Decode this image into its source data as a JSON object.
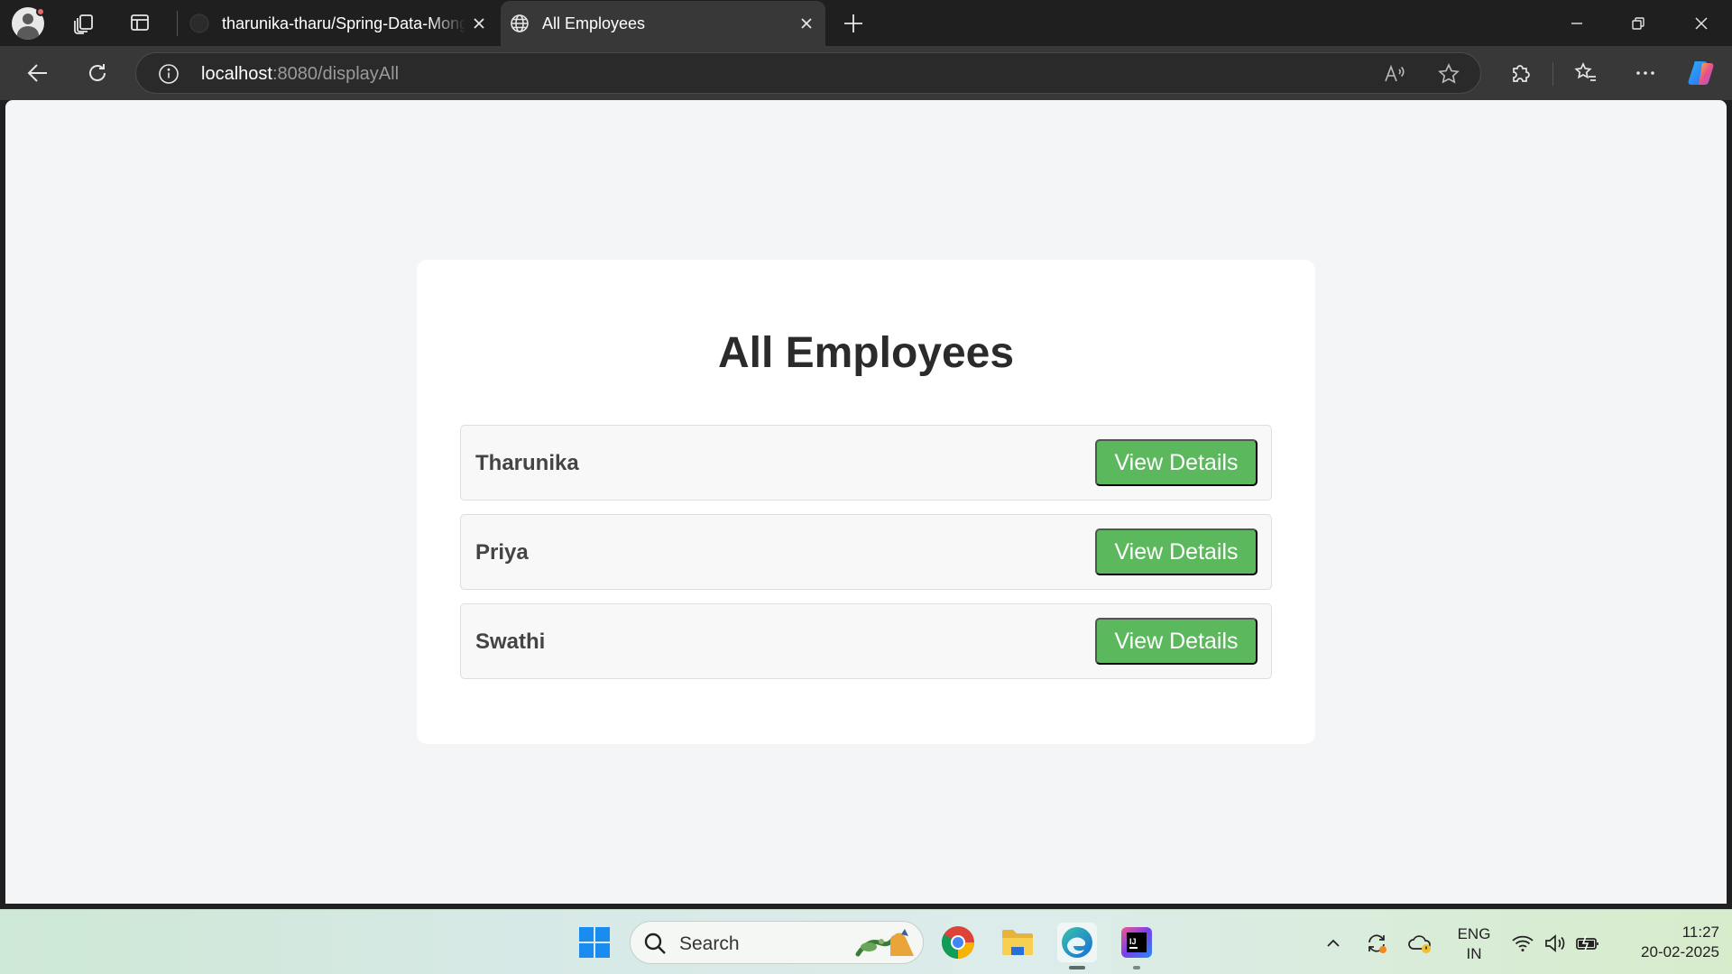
{
  "browser": {
    "tabs": [
      {
        "title": "tharunika-tharu/Spring-Data-Mongo",
        "active": false,
        "favicon": "github-icon"
      },
      {
        "title": "All Employees",
        "active": true,
        "favicon": "globe-icon"
      }
    ],
    "address": {
      "host": "localhost",
      "path": ":8080/displayAll"
    }
  },
  "page": {
    "title": "All Employees",
    "employees": [
      {
        "name": "Tharunika",
        "button_label": "View Details"
      },
      {
        "name": "Priya",
        "button_label": "View Details"
      },
      {
        "name": "Swathi",
        "button_label": "View Details"
      }
    ],
    "button_color": "#5cb85c"
  },
  "taskbar": {
    "search_placeholder": "Search",
    "language": {
      "line1": "ENG",
      "line2": "IN"
    },
    "time": "11:27",
    "date": "20-02-2025"
  }
}
